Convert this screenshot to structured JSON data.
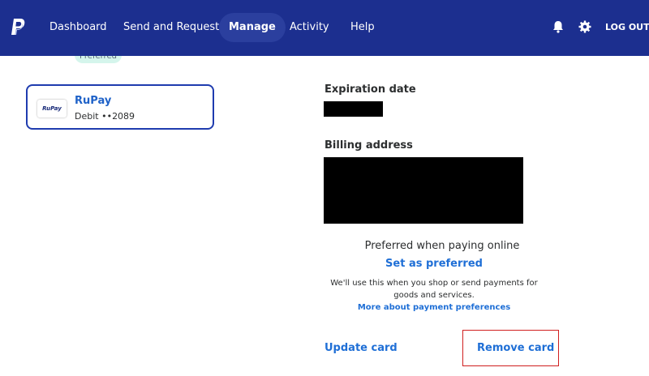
{
  "nav": {
    "logo": "paypal-logo",
    "items": [
      "Dashboard",
      "Send and Request",
      "Manage",
      "Activity",
      "Help"
    ],
    "active": "Manage",
    "logout": "LOG OUT"
  },
  "colors": {
    "nav_bg": "#1c2f8f",
    "accent_blue": "#1f6fd6",
    "card_border": "#1f3caf",
    "highlight_red": "#d01f1f",
    "preferred_tag_bg": "#d5f5ec"
  },
  "preferred_tag": "Preferred",
  "card": {
    "logo_text": "RuPay",
    "name": "RuPay",
    "detail": "Debit ••2089"
  },
  "details": {
    "expiration_label": "Expiration date",
    "billing_label": "Billing address",
    "preferred_title": "Preferred when paying online",
    "set_preferred": "Set as preferred",
    "preferred_desc": "We'll use this when you shop or send payments for goods and services.",
    "more_link": "More about payment preferences",
    "update_card": "Update card",
    "remove_card": "Remove card"
  }
}
